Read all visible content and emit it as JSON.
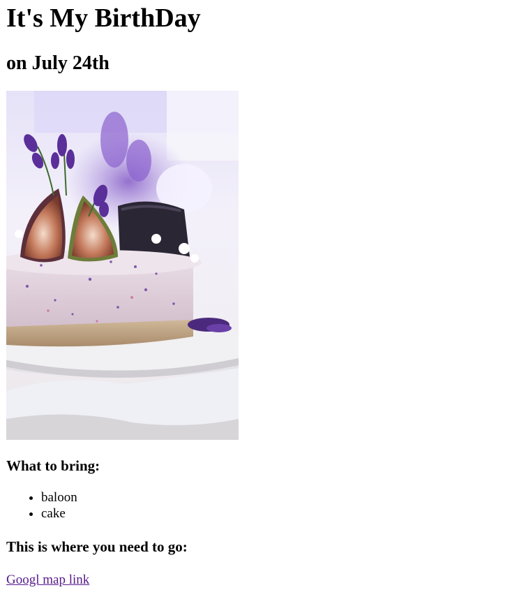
{
  "heading": {
    "title": "It's My BirthDay",
    "date": "on July 24th"
  },
  "bring": {
    "heading": "What to bring:",
    "items": [
      "baloon",
      "cake"
    ]
  },
  "location": {
    "heading": "This is where you need to go:",
    "link_text": "Googl map link"
  },
  "colors": {
    "visited_link": "#551a8b",
    "text": "#000000",
    "background": "#ffffff"
  }
}
